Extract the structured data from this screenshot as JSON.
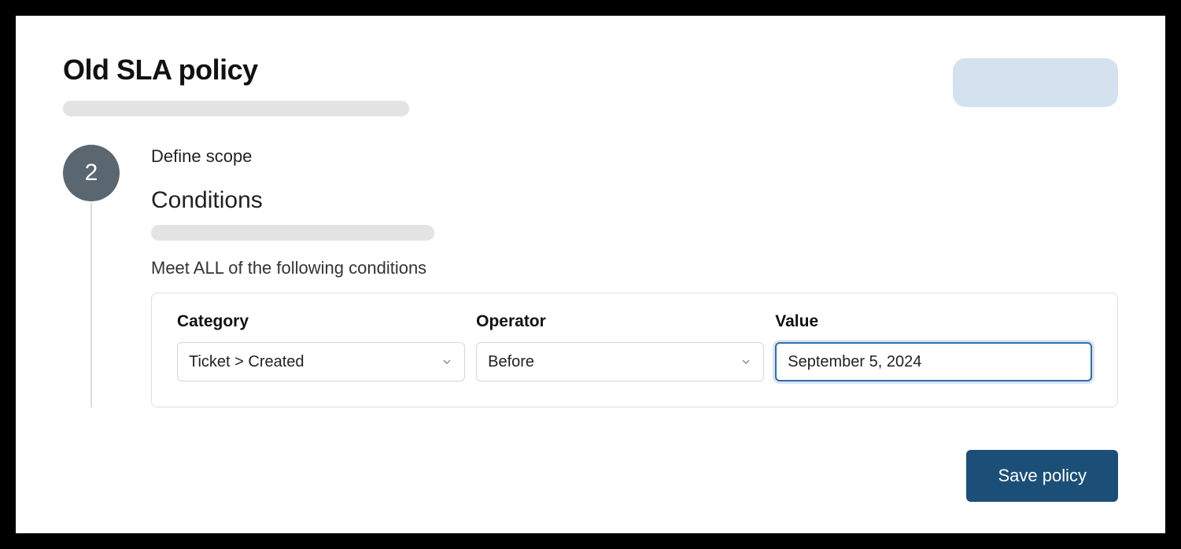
{
  "page": {
    "title": "Old SLA policy"
  },
  "step": {
    "number": "2",
    "label": "Define scope"
  },
  "conditions": {
    "heading": "Conditions",
    "meet_label": "Meet ALL of the following conditions",
    "columns": {
      "category": "Category",
      "operator": "Operator",
      "value": "Value"
    },
    "row": {
      "category": "Ticket > Created",
      "operator": "Before",
      "value": "September 5, 2024"
    }
  },
  "actions": {
    "save": "Save policy"
  }
}
